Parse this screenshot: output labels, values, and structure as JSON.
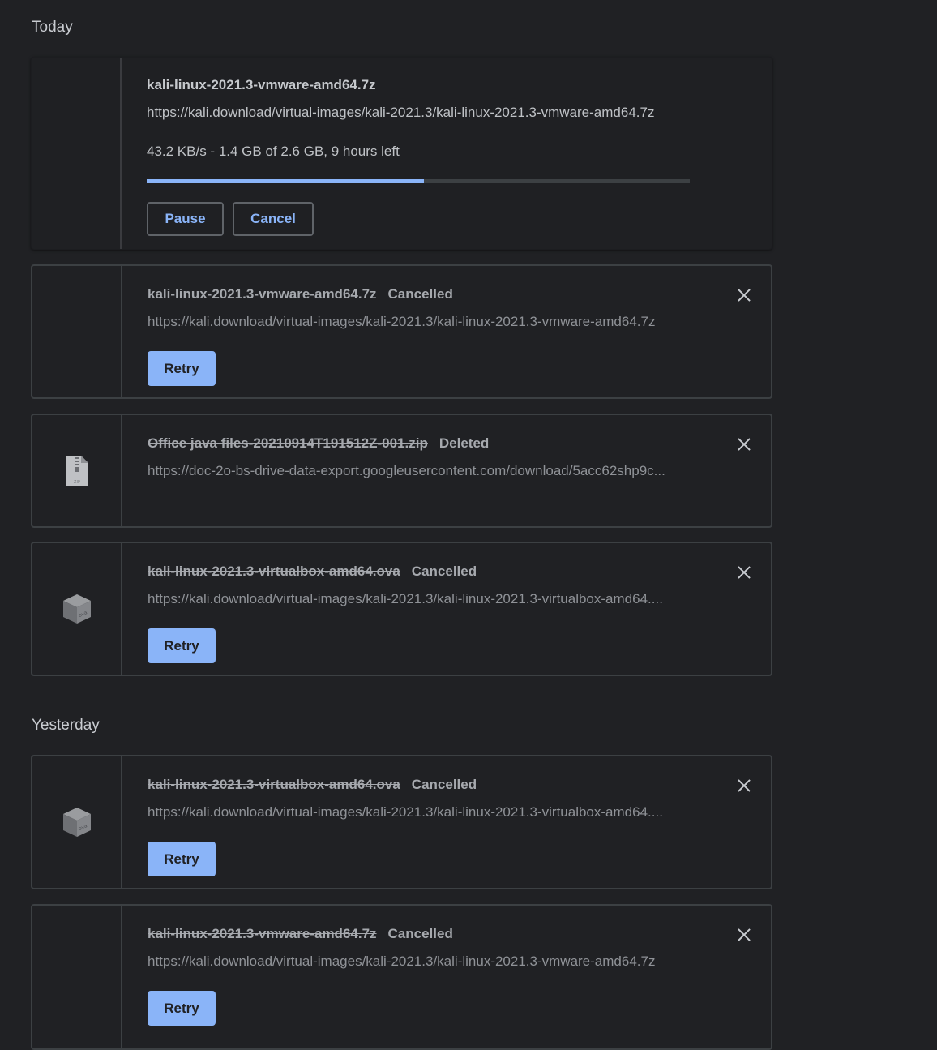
{
  "sections": {
    "today": "Today",
    "yesterday": "Yesterday"
  },
  "active_download": {
    "file_name": "kali-linux-2021.3-vmware-amd64.7z",
    "url": "https://kali.download/virtual-images/kali-2021.3/kali-linux-2021.3-vmware-amd64.7z",
    "progress_text": "43.2 KB/s - 1.4 GB of 2.6 GB, 9 hours left",
    "progress_fraction": 0.51,
    "pause_label": "Pause",
    "cancel_label": "Cancel"
  },
  "today_items": [
    {
      "file_name": "kali-linux-2021.3-vmware-amd64.7z",
      "status": "Cancelled",
      "url": "https://kali.download/virtual-images/kali-2021.3/kali-linux-2021.3-vmware-amd64.7z",
      "retry_label": "Retry",
      "icon": "none"
    },
    {
      "file_name": "Office java files-20210914T191512Z-001.zip",
      "status": "Deleted",
      "url": "https://doc-2o-bs-drive-data-export.googleusercontent.com/download/5acc62shp9c...",
      "icon": "zip-file-icon"
    },
    {
      "file_name": "kali-linux-2021.3-virtualbox-amd64.ova",
      "status": "Cancelled",
      "url": "https://kali.download/virtual-images/kali-2021.3/kali-linux-2021.3-virtualbox-amd64....",
      "retry_label": "Retry",
      "icon": "ova-package-icon"
    }
  ],
  "yesterday_items": [
    {
      "file_name": "kali-linux-2021.3-virtualbox-amd64.ova",
      "status": "Cancelled",
      "url": "https://kali.download/virtual-images/kali-2021.3/kali-linux-2021.3-virtualbox-amd64....",
      "retry_label": "Retry",
      "icon": "ova-package-icon"
    },
    {
      "file_name": "kali-linux-2021.3-vmware-amd64.7z",
      "status": "Cancelled",
      "url": "https://kali.download/virtual-images/kali-2021.3/kali-linux-2021.3-vmware-amd64.7z",
      "retry_label": "Retry",
      "icon": "none"
    }
  ],
  "colors": {
    "background": "#202124",
    "accent": "#8ab4f8",
    "border": "#3c4043"
  }
}
